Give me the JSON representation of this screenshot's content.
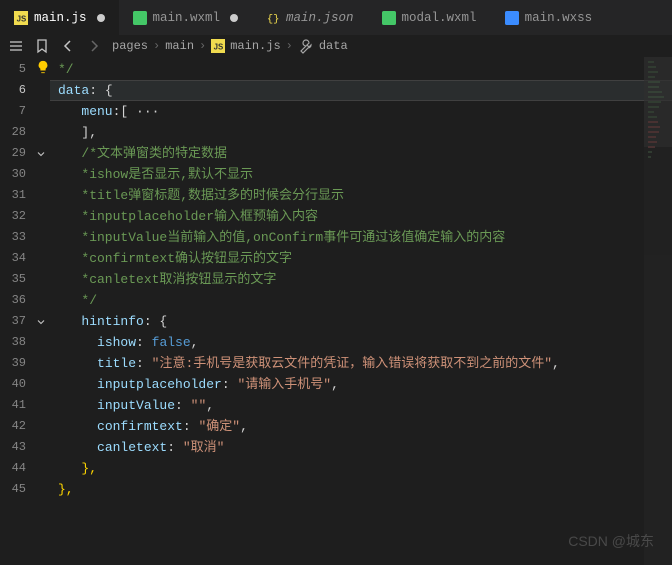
{
  "tabs": [
    {
      "name": "main.js",
      "icon": "js",
      "active": true,
      "dirty": true
    },
    {
      "name": "main.wxml",
      "icon": "wxml",
      "active": false,
      "dirty": true
    },
    {
      "name": "main.json",
      "icon": "json",
      "active": false,
      "italic": true
    },
    {
      "name": "modal.wxml",
      "icon": "wxml",
      "active": false
    },
    {
      "name": "main.wxss",
      "icon": "wxss",
      "active": false
    }
  ],
  "breadcrumbs": {
    "segments": [
      "pages",
      "main",
      "main.js",
      "data"
    ],
    "sep": "›"
  },
  "line_numbers": [
    "5",
    "6",
    "7",
    "28",
    "29",
    "30",
    "31",
    "32",
    "33",
    "34",
    "35",
    "36",
    "37",
    "38",
    "39",
    "40",
    "41",
    "42",
    "43",
    "44",
    "45"
  ],
  "current_line_index": 1,
  "fold_markers": {
    "4": "down",
    "12": "down"
  },
  "code": {
    "l5": "*/",
    "l6_key": "data",
    "l6_colon": ": {",
    "l7_key": "menu",
    "l7_rest": ":[ ···",
    "l28": "],",
    "l29": "/*文本弹窗类的特定数据",
    "l30": "*ishow是否显示,默认不显示",
    "l31": "*title弹窗标题,数据过多的时候会分行显示",
    "l32": "*inputplaceholder输入框预输入内容",
    "l33": "*inputValue当前输入的值,onConfirm事件可通过该值确定输入的内容",
    "l34": "*confirmtext确认按钮显示的文字",
    "l35": "*canletext取消按钮显示的文字",
    "l36": "*/",
    "l37_key": "hintinfo",
    "l37_rest": ": {",
    "l38_key": "ishow",
    "l38_colon": ": ",
    "l38_val": "false",
    "l39_key": "title",
    "l39_colon": ": ",
    "l39_val": "\"注意:手机号是获取云文件的凭证，输入错误将获取不到之前的文件\"",
    "l40_key": "inputplaceholder",
    "l40_colon": ": ",
    "l40_val": "\"请输入手机号\"",
    "l41_key": "inputValue",
    "l41_colon": ": ",
    "l41_val": "\"\"",
    "l42_key": "confirmtext",
    "l42_colon": ": ",
    "l42_val": "\"确定\"",
    "l43_key": "canletext",
    "l43_colon": ": ",
    "l43_val": "\"取消\"",
    "l44": "},",
    "l45": "},",
    "comma": ","
  },
  "watermark": "CSDN @城东"
}
